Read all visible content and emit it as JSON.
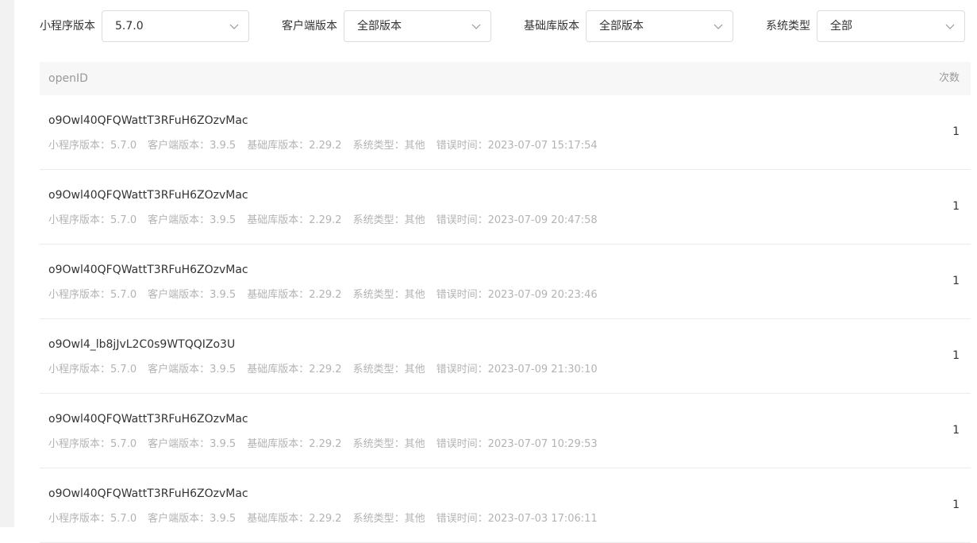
{
  "filters": {
    "mini_program_version": {
      "label": "小程序版本",
      "value": "5.7.0"
    },
    "client_version": {
      "label": "客户端版本",
      "value": "全部版本"
    },
    "base_lib_version": {
      "label": "基础库版本",
      "value": "全部版本"
    },
    "system_type": {
      "label": "系统类型",
      "value": "全部"
    }
  },
  "table": {
    "columns": {
      "openid": "openID",
      "count": "次数"
    },
    "meta_labels": {
      "mini_program_version": "小程序版本：",
      "client_version": "客户端版本：",
      "base_lib_version": "基础库版本：",
      "system_type": "系统类型：",
      "error_time": "错误时间："
    },
    "rows": [
      {
        "openid": "o9Owl40QFQWattT3RFuH6ZOzvMac",
        "mini_program_version": "5.7.0",
        "client_version": "3.9.5",
        "base_lib_version": "2.29.2",
        "system_type": "其他",
        "error_time": "2023-07-07 15:17:54",
        "count": "1"
      },
      {
        "openid": "o9Owl40QFQWattT3RFuH6ZOzvMac",
        "mini_program_version": "5.7.0",
        "client_version": "3.9.5",
        "base_lib_version": "2.29.2",
        "system_type": "其他",
        "error_time": "2023-07-09 20:47:58",
        "count": "1"
      },
      {
        "openid": "o9Owl40QFQWattT3RFuH6ZOzvMac",
        "mini_program_version": "5.7.0",
        "client_version": "3.9.5",
        "base_lib_version": "2.29.2",
        "system_type": "其他",
        "error_time": "2023-07-09 20:23:46",
        "count": "1"
      },
      {
        "openid": "o9Owl4_lb8jJvL2C0s9WTQQIZo3U",
        "mini_program_version": "5.7.0",
        "client_version": "3.9.5",
        "base_lib_version": "2.29.2",
        "system_type": "其他",
        "error_time": "2023-07-09 21:30:10",
        "count": "1"
      },
      {
        "openid": "o9Owl40QFQWattT3RFuH6ZOzvMac",
        "mini_program_version": "5.7.0",
        "client_version": "3.9.5",
        "base_lib_version": "2.29.2",
        "system_type": "其他",
        "error_time": "2023-07-07 10:29:53",
        "count": "1"
      },
      {
        "openid": "o9Owl40QFQWattT3RFuH6ZOzvMac",
        "mini_program_version": "5.7.0",
        "client_version": "3.9.5",
        "base_lib_version": "2.29.2",
        "system_type": "其他",
        "error_time": "2023-07-03 17:06:11",
        "count": "1"
      }
    ]
  }
}
